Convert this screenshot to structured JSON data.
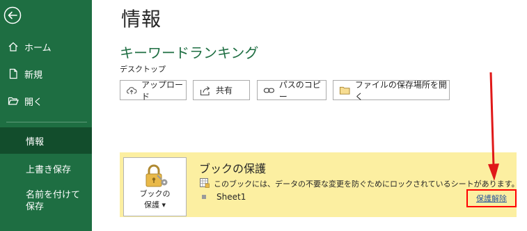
{
  "sidebar": {
    "items": [
      {
        "id": "home",
        "label": "ホーム",
        "icon": "home-icon"
      },
      {
        "id": "new",
        "label": "新規",
        "icon": "new-file-icon"
      },
      {
        "id": "open",
        "label": "開く",
        "icon": "folder-open-icon"
      },
      {
        "id": "info",
        "label": "情報",
        "active": true
      },
      {
        "id": "save",
        "label": "上書き保存"
      },
      {
        "id": "saveas",
        "label": "名前を付けて保存"
      }
    ],
    "colors": {
      "background": "#1e6e42",
      "active": "#124d2c"
    }
  },
  "main": {
    "title": "情報",
    "file_name": "キーワードランキング",
    "file_location": "デスクトップ",
    "buttons": [
      {
        "id": "upload",
        "label": "アップロード",
        "icon": "cloud-upload-icon"
      },
      {
        "id": "share",
        "label": "共有",
        "icon": "share-icon"
      },
      {
        "id": "copy-path",
        "label": "パスのコピー",
        "icon": "link-icon"
      },
      {
        "id": "open-location",
        "label": "ファイルの保存場所を開く",
        "icon": "folder-icon"
      }
    ]
  },
  "protect": {
    "button_label_line1": "ブックの",
    "button_label_line2": "保護 ▾",
    "title": "ブックの保護",
    "description": "このブックには、データの不要な変更を防ぐためにロックされているシートがあります。",
    "sheet": "Sheet1",
    "unprotect_label": "保護解除",
    "colors": {
      "background": "#fcefa1",
      "highlight": "#ff0000",
      "link": "#2b579a"
    }
  }
}
